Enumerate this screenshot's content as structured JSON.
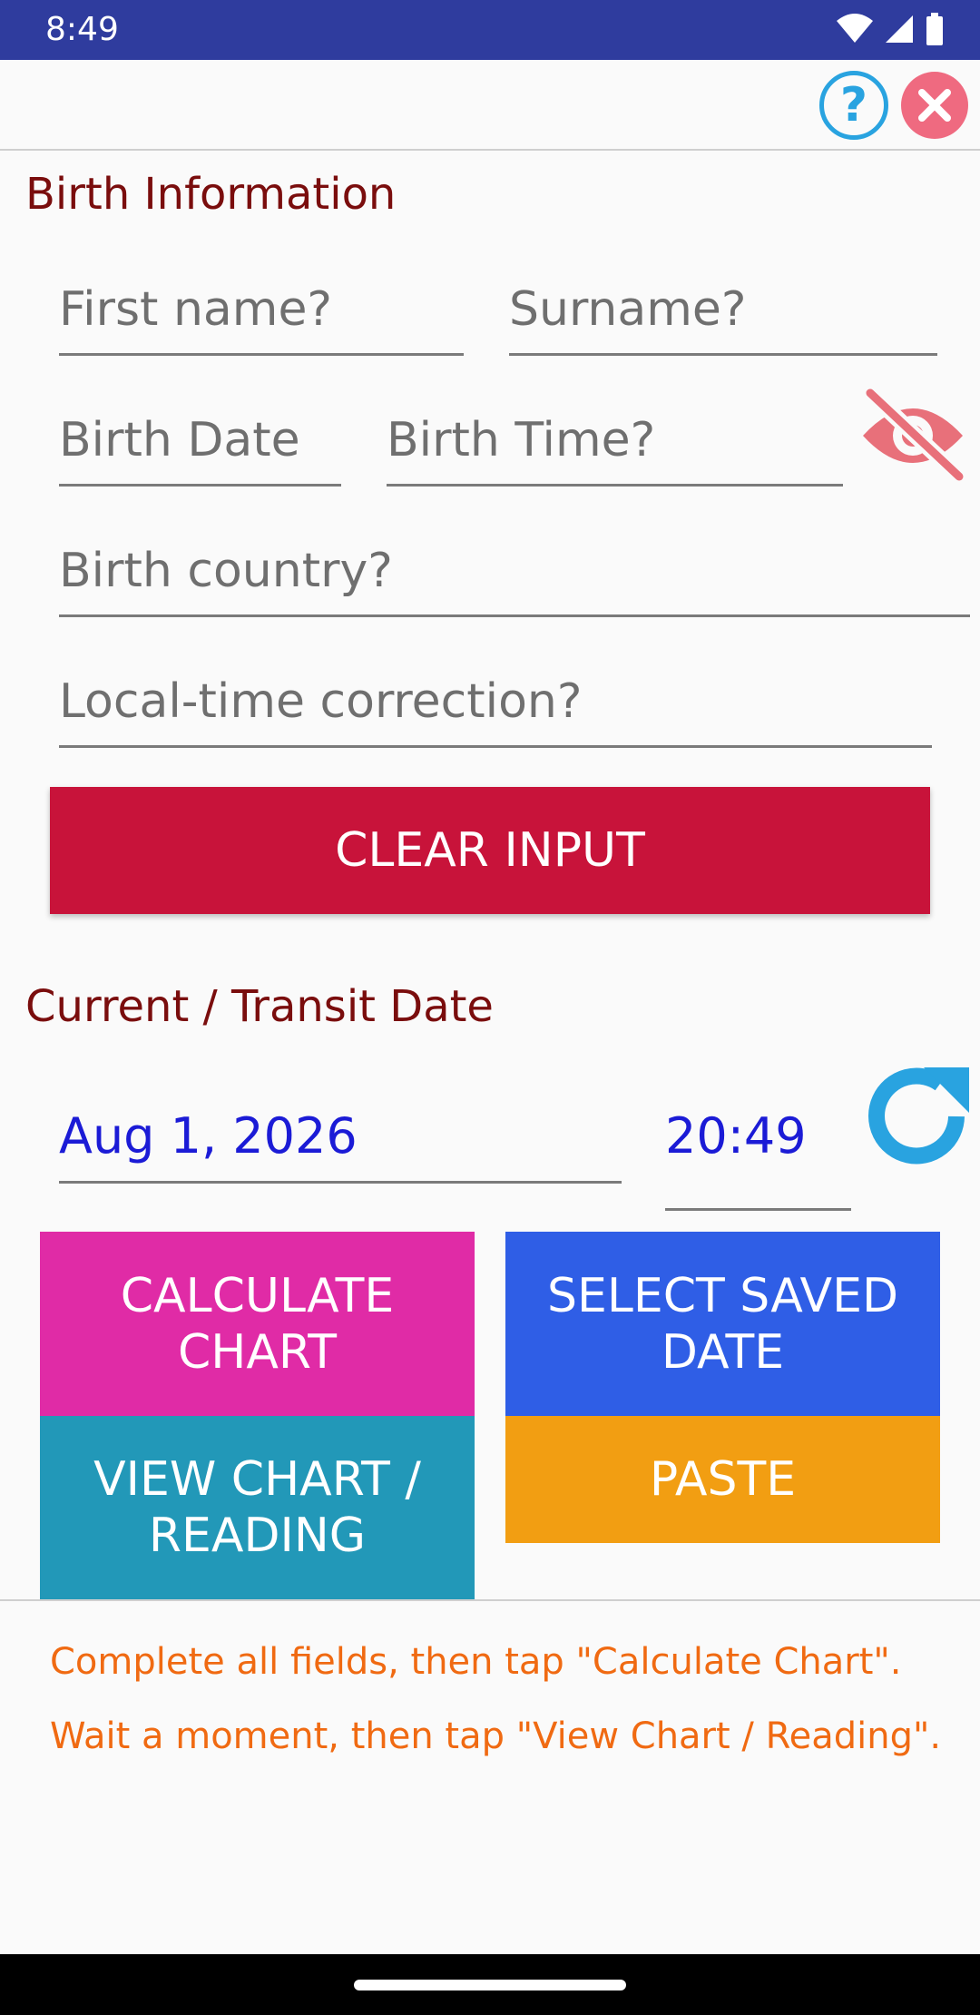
{
  "status_bar": {
    "time": "8:49",
    "icons": [
      "wifi-icon",
      "cellular-signal-icon",
      "battery-icon"
    ]
  },
  "top_bar": {
    "help_label": "?",
    "icons": [
      "help-icon",
      "close-icon"
    ]
  },
  "birth_section": {
    "title": "Birth Information",
    "first_name": {
      "value": "",
      "placeholder": "First name?"
    },
    "surname": {
      "value": "",
      "placeholder": "Surname?"
    },
    "birth_date": {
      "value": "",
      "placeholder": "Birth Date"
    },
    "birth_time": {
      "value": "",
      "placeholder": "Birth Time?"
    },
    "birth_country": {
      "value": "",
      "placeholder": "Birth country?"
    },
    "local_time_correction": {
      "value": "",
      "placeholder": "Local-time correction?"
    },
    "visibility_icon": "eye-off-icon",
    "clear_button": "CLEAR INPUT"
  },
  "transit_section": {
    "title": "Current / Transit Date",
    "date": "Aug 1, 2026",
    "time": "20:49",
    "refresh_icon": "refresh-icon"
  },
  "actions": {
    "calculate_chart": "CALCULATE CHART",
    "select_saved_date": "SELECT SAVED DATE",
    "view_chart_reading": "VIEW CHART / READING",
    "paste": "PASTE"
  },
  "instructions": {
    "line1": "Complete all fields, then tap \"Calculate Chart\".",
    "line2": "Wait a moment, then tap \"View Chart / Reading\"."
  },
  "colors": {
    "status_bar": "#2f3c9e",
    "section_title": "#7a0d0d",
    "clear_button": "#c8133a",
    "calculate": "#e02ba6",
    "select_saved": "#2f5ee6",
    "view_chart": "#2298b8",
    "paste": "#f29e12",
    "instructions": "#f06a12",
    "transit_value": "#1b1bd6",
    "help": "#29a3e0",
    "close": "#ef6a80"
  }
}
